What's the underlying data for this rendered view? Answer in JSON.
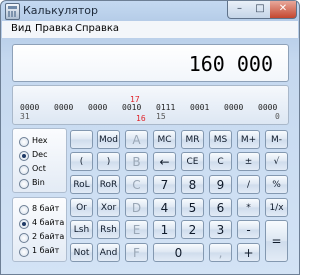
{
  "window": {
    "title": "Калькулятор"
  },
  "titlebar_buttons": {
    "minimize": "–",
    "maximize": "□",
    "close": "✕"
  },
  "menu": [
    "Вид",
    "Правка",
    "Справка"
  ],
  "display": {
    "value": "160 000"
  },
  "bits": {
    "markers": [
      "17",
      "16"
    ],
    "nibbles": [
      "0000",
      "0000",
      "0000",
      "0010",
      "0111",
      "0001",
      "0000",
      "0000"
    ],
    "positions": [
      "31",
      "15",
      "0"
    ]
  },
  "base_options": [
    {
      "label": "Hex",
      "checked": false
    },
    {
      "label": "Dec",
      "checked": true
    },
    {
      "label": "Oct",
      "checked": false
    },
    {
      "label": "Bin",
      "checked": false
    }
  ],
  "word_options": [
    {
      "label": "8 байт",
      "checked": false
    },
    {
      "label": "4 байта",
      "checked": true
    },
    {
      "label": "2 байта",
      "checked": false
    },
    {
      "label": "1 байт",
      "checked": false
    }
  ],
  "buttons": {
    "row1": [
      "",
      "Mod",
      "A",
      "MC",
      "MR",
      "MS",
      "M+",
      "M-"
    ],
    "row2": [
      "(",
      ")",
      "B",
      "←",
      "CE",
      "C",
      "±",
      "√"
    ],
    "row3": [
      "RoL",
      "RoR",
      "C",
      "7",
      "8",
      "9",
      "/",
      "%"
    ],
    "row4": [
      "Or",
      "Xor",
      "D",
      "4",
      "5",
      "6",
      "*",
      "1/x"
    ],
    "row5": [
      "Lsh",
      "Rsh",
      "E",
      "1",
      "2",
      "3",
      "-",
      "="
    ],
    "row6": [
      "Not",
      "And",
      "F",
      "0",
      ",",
      "+"
    ]
  },
  "icons": {
    "app": "calculator-icon"
  }
}
